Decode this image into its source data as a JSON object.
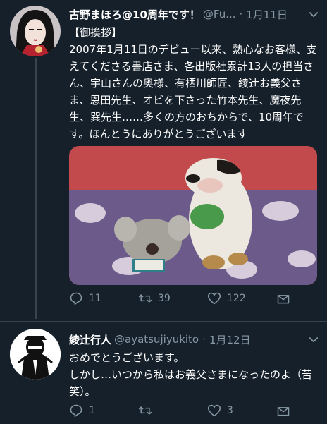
{
  "tweets": [
    {
      "name": "古野まほろ@10周年です！",
      "handle": "@Fu...",
      "separator": "·",
      "date": "1月11日",
      "text": "【御挨拶】\n2007年1月11日のデビュー以来、熱心なお客様、支えてくださる書店さま、各出版社累計13人の担当さん、宇山さんの奥様、有栖川師匠、綾辻お義父さま、恩田先生、オビを下さった竹本先生、魔夜先生、巽先生……多くの方のおちからで、10周年です。ほんとうにありがとうございます",
      "replies": "11",
      "retweets": "39",
      "likes": "122"
    },
    {
      "name": "綾辻行人",
      "handle": "@ayatsujiyukito",
      "separator": "·",
      "date": "1月12日",
      "text": "おめでとうございます。\nしかし…いつから私はお義父さまになったのよ（苦笑）。",
      "replies": "1",
      "retweets": "",
      "likes": "3"
    }
  ],
  "icons": [
    "caret-down-icon",
    "reply-icon",
    "retweet-icon",
    "like-icon",
    "share-icon"
  ],
  "colors": {
    "background": "#15202b",
    "secondary_text": "#8899a6",
    "divider": "#38444d"
  }
}
